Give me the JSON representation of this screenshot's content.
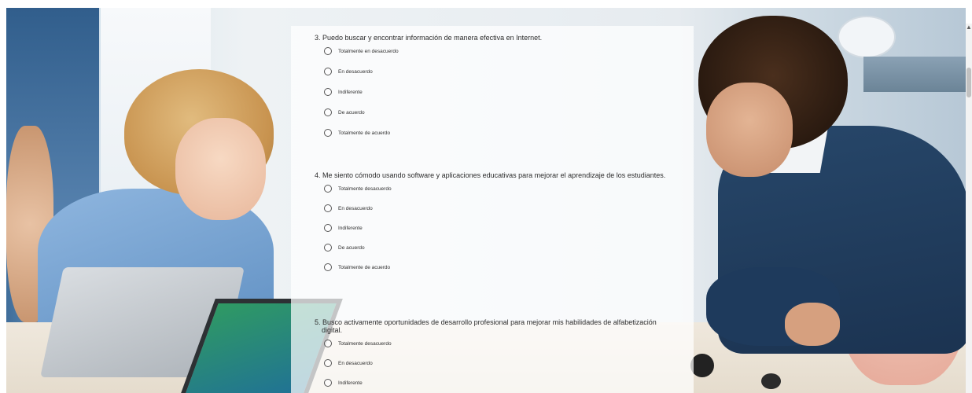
{
  "questions": [
    {
      "title": "3. Puedo buscar y encontrar información de manera efectiva en Internet.",
      "options": [
        "Totalmente en desacuerdo",
        "En desacuerdo",
        "Indiferente",
        "De acuerdo",
        "Totalmente de acuerdo"
      ]
    },
    {
      "title": "4. Me siento cómodo usando software y aplicaciones educativas para mejorar el aprendizaje de los estudiantes.",
      "options": [
        "Totalmente desacuerdo",
        "En desacuerdo",
        "Indiferente",
        "De acuerdo",
        "Totalmente de acuerdo"
      ]
    },
    {
      "title": "5. Busco activamente oportunidades de desarrollo profesional para mejorar mis habilidades de alfabetización digital.",
      "options": [
        "Totalmente desacuerdo",
        "En desacuerdo",
        "Indiferente"
      ]
    }
  ],
  "scrollbar": {
    "up_arrow": "▲"
  }
}
